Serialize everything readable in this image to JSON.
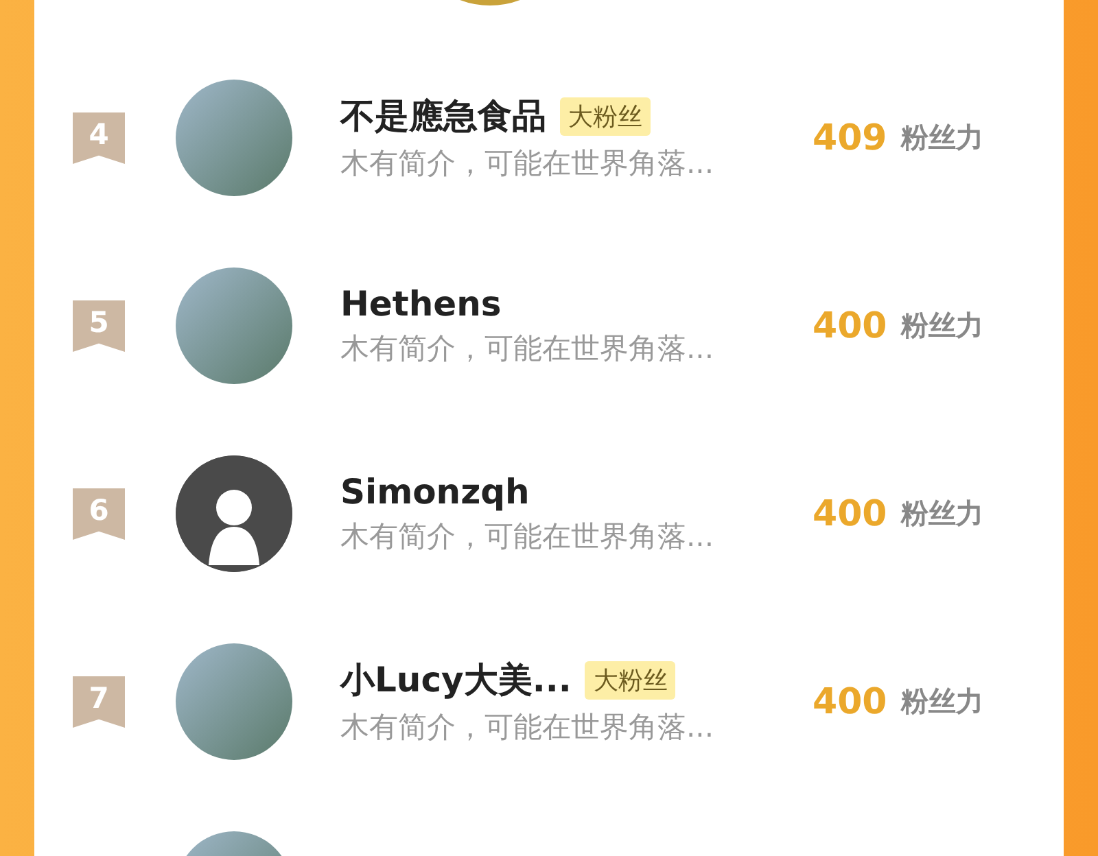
{
  "rows": [
    {
      "rank": "4",
      "avatar": {
        "kind": "photo"
      },
      "name": "不是應急食品",
      "badge": "大粉丝",
      "bio": "木有简介，可能在世界角落...",
      "count": "409",
      "count_label": "粉丝力"
    },
    {
      "rank": "5",
      "avatar": {
        "kind": "photo"
      },
      "name": "Hethens",
      "bio": "木有简介，可能在世界角落...",
      "count": "400",
      "count_label": "粉丝力"
    },
    {
      "rank": "6",
      "avatar": {
        "kind": "default"
      },
      "name": "Simonzqh",
      "bio": "木有简介，可能在世界角落...",
      "count": "400",
      "count_label": "粉丝力"
    },
    {
      "rank": "7",
      "avatar": {
        "kind": "photo"
      },
      "name": "小Lucy大美...",
      "badge": "大粉丝",
      "bio": "木有简介，可能在世界角落...",
      "count": "400",
      "count_label": "粉丝力"
    }
  ]
}
